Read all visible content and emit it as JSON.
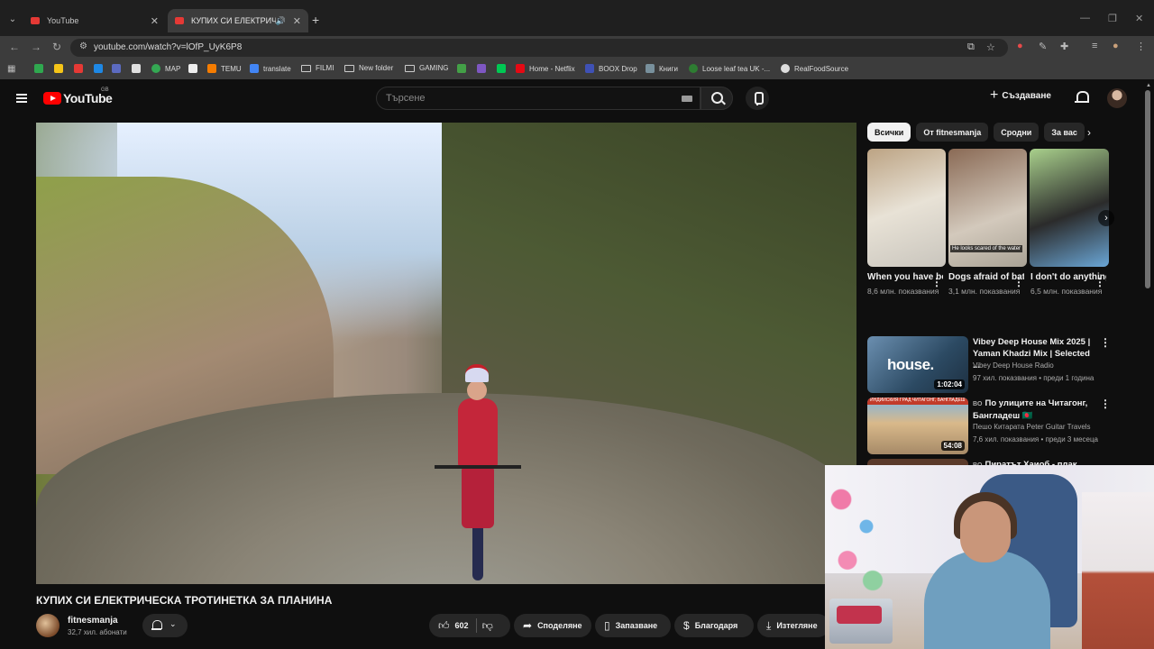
{
  "browser": {
    "tabs": [
      {
        "title": "YouTube",
        "active": false
      },
      {
        "title": "КУПИХ СИ ЕЛЕКТРИЧЕСК",
        "active": true
      }
    ],
    "new_tab": "+",
    "url": "youtube.com/watch?v=lOfP_UyK6P8",
    "bookmarks": [
      "MAP",
      "TEMU",
      "translate",
      "FILMI",
      "New folder",
      "GAMING",
      "Home - Netflix",
      "BOOX Drop",
      "Книги",
      "Loose leaf tea UK -...",
      "RealFoodSource"
    ]
  },
  "youtube": {
    "logo_text": "YouTube",
    "logo_country": "GB",
    "search_placeholder": "Търсене",
    "create_label": "Създаване"
  },
  "video": {
    "title": "КУПИХ СИ ЕЛЕКТРИЧЕСКА ТРОТИНЕТКА ЗА ПЛАНИНА",
    "channel": "fitnesmanja",
    "subscribers": "32,7 хил. абонати",
    "likes": "602",
    "share_label": "Споделяне",
    "save_label": "Запазване",
    "thanks_label": "Благодаря",
    "download_label": "Изтегляне"
  },
  "chips": [
    "Всички",
    "От fitnesmanja",
    "Сродни",
    "За вас"
  ],
  "shorts": [
    {
      "title": "When you have both a...",
      "views": "8,6 млн. показвания",
      "caption": ""
    },
    {
      "title": "Dogs afraid of bathing ...",
      "views": "3,1 млн. показвания",
      "caption": "He looks scared of the water"
    },
    {
      "title": "I don't do anything ...",
      "views": "6,5 млн. показвания",
      "caption": ""
    }
  ],
  "recommendations": [
    {
      "title": "Vibey Deep House Mix 2025 | Yaman Khadzi Mix | Selected ...",
      "channel": "Vibey Deep House Radio",
      "meta": "97 хил. показвания • преди 1 година",
      "duration": "1:02:04",
      "thumb_text": "house."
    },
    {
      "prefix": "BO",
      "title": "По улиците на Читагонг, Бангладеш 🇧🇩",
      "channel": "Пешо Китарата Peter Guitar Travels",
      "meta": "7,6 хил. показвания • преди 3 месеца",
      "duration": "54:08",
      "thumb_text": "ИНДИЙСКИЯ ГРАД ЧИТАГОНГ, БАНГЛАДЕШ"
    },
    {
      "prefix": "BO",
      "title": "Пиратът Хаиоб - плак през ..."
    }
  ]
}
